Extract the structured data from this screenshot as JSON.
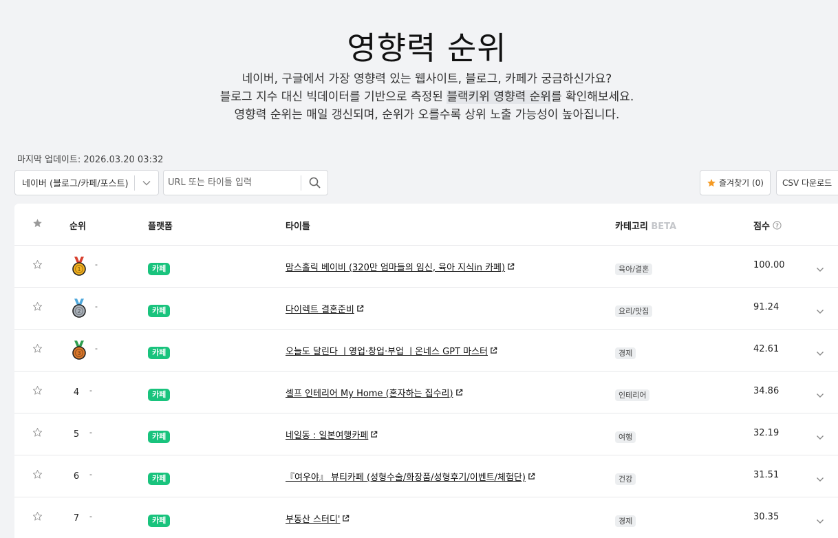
{
  "hero": {
    "title": "영향력 순위",
    "line1": "네이버, 구글에서 가장 영향력 있는 웹사이트, 블로그, 카페가 궁금하신가요?",
    "line2_pre": "블로그 지수 대신 빅데이터를 기반으로 측정된 ",
    "line2_hl": "블랙키위 영향력 순위",
    "line2_post": "를 확인해보세요.",
    "line3": "영향력 순위는 매일 갱신되며, 순위가 오를수록 상위 노출 가능성이 높아집니다."
  },
  "update": {
    "label": "마지막 업데이트: 2026.03.20 03:32"
  },
  "controls": {
    "platform_select": "네이버 (블로그/카페/포스트)",
    "search_placeholder": "URL 또는 타이틀 입력",
    "favorites_label": "즐겨찾기 (0)",
    "csv_label": "CSV 다운로드"
  },
  "table": {
    "headers": {
      "rank": "순위",
      "platform": "플랫폼",
      "title": "타이틀",
      "category": "카테고리",
      "category_tag": "BETA",
      "score": "점수"
    },
    "rows": [
      {
        "rank": "",
        "medal": "gold",
        "change": "-",
        "platform": "카페",
        "title": "맘스홀릭 베이비 (320만 엄마들의 임신, 육아 지식in 카페)",
        "category": "육아/결혼",
        "score": "100.00"
      },
      {
        "rank": "",
        "medal": "silver",
        "change": "-",
        "platform": "카페",
        "title": "다이렉트 결혼준비",
        "category": "요리/맛집",
        "score": "91.24"
      },
      {
        "rank": "",
        "medal": "bronze",
        "change": "-",
        "platform": "카페",
        "title": "오늘도 달린다 ㅣ영업·창업·부업 ㅣ온네스 GPT 마스터",
        "category": "경제",
        "score": "42.61"
      },
      {
        "rank": "4",
        "medal": "",
        "change": "-",
        "platform": "카페",
        "title": "셀프 인테리어 My Home (혼자하는 집수리)",
        "category": "인테리어",
        "score": "34.86"
      },
      {
        "rank": "5",
        "medal": "",
        "change": "-",
        "platform": "카페",
        "title": "네일동 : 일본여행카페",
        "category": "여행",
        "score": "32.19"
      },
      {
        "rank": "6",
        "medal": "",
        "change": "-",
        "platform": "카페",
        "title": "『여우야』 뷰티카페 (성형수술/화장품/성형후기/이벤트/체험단)",
        "category": "건강",
        "score": "31.51"
      },
      {
        "rank": "7",
        "medal": "",
        "change": "-",
        "platform": "카페",
        "title": "부동산 스터디'",
        "category": "경제",
        "score": "30.35"
      }
    ]
  },
  "colors": {
    "badge_green": "#19c37d",
    "fav_star": "#f59a23",
    "gold": "#f2b01e",
    "silver": "#a9b0b8",
    "bronze": "#d9772b",
    "ribbon_red": "#d8402f",
    "ribbon_blue": "#4fa8dc",
    "ribbon_green": "#2e9e4f"
  }
}
